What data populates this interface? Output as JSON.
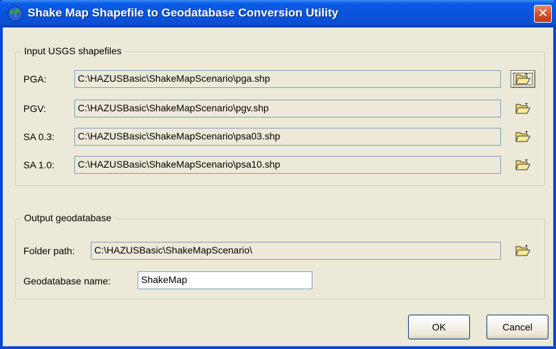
{
  "window": {
    "title": "Shake Map Shapefile to Geodatabase Conversion Utility",
    "close_glyph": "✕"
  },
  "input_group": {
    "legend": "Input USGS shapefiles",
    "rows": [
      {
        "label": "PGA:",
        "value": "C:\\HAZUSBasic\\ShakeMapScenario\\pga.shp"
      },
      {
        "label": "PGV:",
        "value": "C:\\HAZUSBasic\\ShakeMapScenario\\pgv.shp"
      },
      {
        "label": "SA 0.3:",
        "value": "C:\\HAZUSBasic\\ShakeMapScenario\\psa03.shp"
      },
      {
        "label": "SA 1.0:",
        "value": "C:\\HAZUSBasic\\ShakeMapScenario\\psa10.shp"
      }
    ]
  },
  "output_group": {
    "legend": "Output geodatabase",
    "folder_label": "Folder path:",
    "folder_value": "C:\\HAZUSBasic\\ShakeMapScenario\\",
    "name_label": "Geodatabase name:",
    "name_value": "ShakeMap"
  },
  "buttons": {
    "ok": "OK",
    "cancel": "Cancel"
  },
  "colors": {
    "title_bar": "#0a54dd",
    "close_button": "#d24e2c",
    "dialog_face": "#ece9d8"
  },
  "icons": {
    "app": "globe-icon",
    "browse": "open-folder-icon"
  }
}
